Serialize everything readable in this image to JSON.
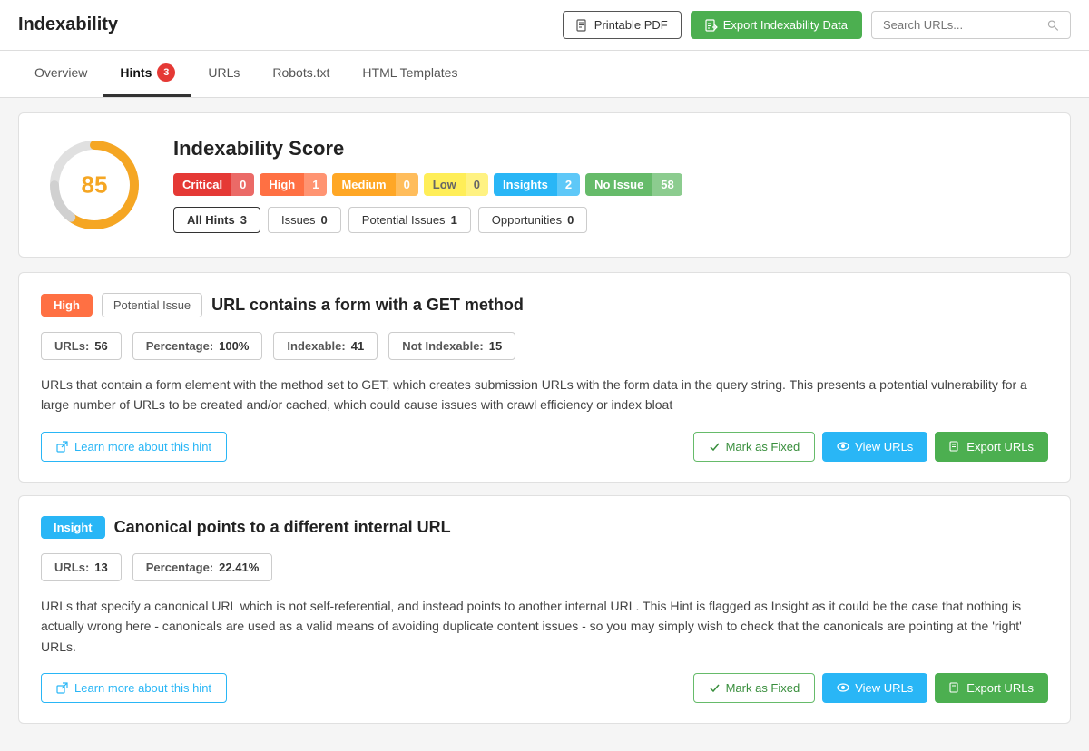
{
  "app": {
    "title": "Indexability"
  },
  "topbar": {
    "pdf_button": "Printable PDF",
    "export_button": "Export Indexability Data",
    "search_placeholder": "Search URLs..."
  },
  "tabs": [
    {
      "id": "overview",
      "label": "Overview",
      "active": false
    },
    {
      "id": "hints",
      "label": "Hints",
      "active": true,
      "badge": "3"
    },
    {
      "id": "urls",
      "label": "URLs",
      "active": false
    },
    {
      "id": "robots",
      "label": "Robots.txt",
      "active": false
    },
    {
      "id": "html_templates",
      "label": "HTML Templates",
      "active": false
    }
  ],
  "score_card": {
    "title": "Indexability Score",
    "score": "85",
    "badges": [
      {
        "id": "critical",
        "label": "Critical",
        "count": "0",
        "class": "badge-critical"
      },
      {
        "id": "high",
        "label": "High",
        "count": "1",
        "class": "badge-high"
      },
      {
        "id": "medium",
        "label": "Medium",
        "count": "0",
        "class": "badge-medium"
      },
      {
        "id": "low",
        "label": "Low",
        "count": "0",
        "class": "badge-low"
      },
      {
        "id": "insights",
        "label": "Insights",
        "count": "2",
        "class": "badge-insights"
      },
      {
        "id": "noissue",
        "label": "No Issue",
        "count": "58",
        "class": "badge-noissue"
      }
    ],
    "filters": [
      {
        "id": "all",
        "label": "All Hints",
        "count": "3",
        "active": true
      },
      {
        "id": "issues",
        "label": "Issues",
        "count": "0",
        "active": false
      },
      {
        "id": "potential",
        "label": "Potential Issues",
        "count": "1",
        "active": false
      },
      {
        "id": "opportunities",
        "label": "Opportunities",
        "count": "0",
        "active": false
      }
    ]
  },
  "hints": [
    {
      "id": "hint-1",
      "severity": "High",
      "severity_class": "severity-high",
      "type": "Potential Issue",
      "title": "URL contains a form with a GET method",
      "stats": [
        {
          "label": "URLs:",
          "value": "56"
        },
        {
          "label": "Percentage:",
          "value": "100%"
        },
        {
          "label": "Indexable:",
          "value": "41"
        },
        {
          "label": "Not Indexable:",
          "value": "15"
        }
      ],
      "description": "URLs that contain a form element with the method set to GET, which creates submission URLs with the form data in the query string. This presents a potential vulnerability for a large number of URLs to be created and/or cached, which could cause issues with crawl efficiency or index bloat",
      "learn_more": "Learn more about this hint",
      "mark_fixed": "Mark as Fixed",
      "view_urls": "View URLs",
      "export_urls": "Export URLs"
    },
    {
      "id": "hint-2",
      "severity": "Insight",
      "severity_class": "severity-insight",
      "type": null,
      "title": "Canonical points to a different internal URL",
      "stats": [
        {
          "label": "URLs:",
          "value": "13"
        },
        {
          "label": "Percentage:",
          "value": "22.41%"
        }
      ],
      "description": "URLs that specify a canonical URL which is not self-referential, and instead points to another internal URL. This Hint is flagged as Insight as it could be the case that nothing is actually wrong here - canonicals are used as a valid means of avoiding duplicate content issues - so you may simply wish to check that the canonicals are pointing at the 'right' URLs.",
      "learn_more": "Learn more about this hint",
      "mark_fixed": "Mark as Fixed",
      "view_urls": "View URLs",
      "export_urls": "Export URLs"
    }
  ]
}
